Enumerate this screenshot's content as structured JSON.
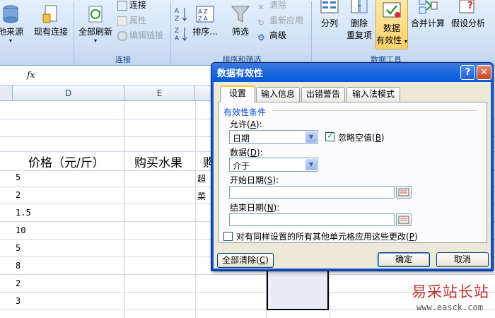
{
  "ribbon": {
    "get_data": {
      "from_other_sources": "他来源",
      "existing_connections": "现有连接"
    },
    "connections": {
      "refresh_all": "全部刷新",
      "connections": "连接",
      "properties": "属性",
      "edit_links": "编辑链接",
      "group_title": "连接"
    },
    "sort_filter": {
      "sort": "排序...",
      "filter": "筛选",
      "clear": "清除",
      "reapply": "重新应用",
      "advanced": "高级",
      "group_title": "排序和筛选"
    },
    "data_tools": {
      "text_to_columns": "分列",
      "remove_duplicates_1": "删除",
      "remove_duplicates_2": "重复项",
      "data_validation_1": "数据",
      "data_validation_2": "有效性",
      "consolidate": "合并计算",
      "what_if_1": "假设分析",
      "group_title": "数据工具"
    }
  },
  "formula_bar": {
    "fx": "fx"
  },
  "columns": [
    "D",
    "E",
    "F"
  ],
  "sheet": {
    "header_price": "价格（元/斤）",
    "header_fruit": "购买水果",
    "header_f_partial": "购",
    "values": [
      "5",
      "2",
      "1.5",
      "10",
      "5",
      "8",
      "2",
      "3"
    ],
    "f_col_partial": [
      "超",
      "菜"
    ]
  },
  "dialog": {
    "title": "数据有效性",
    "help": "?",
    "close": "✕",
    "tabs": [
      "设置",
      "输入信息",
      "出错警告",
      "输入法模式"
    ],
    "section_title": "有效性条件",
    "allow_label": "允许(",
    "allow_key": "A",
    "allow_value": "日期",
    "ignore_blank_label": "忽略空值(",
    "ignore_blank_key": "B",
    "data_label": "数据(",
    "data_key": "D",
    "data_value": "介于",
    "start_date_label": "开始日期(",
    "start_date_key": "S",
    "end_date_label": "结束日期(",
    "end_date_key": "N",
    "apply_all_label": "对有同样设置的所有其他单元格应用这些更改(",
    "apply_all_key": "P",
    "close_paren": "):",
    "close_paren_plain": ")",
    "clear_all": "全部清除(",
    "clear_all_key": "C",
    "ok": "确定",
    "cancel": "取消"
  },
  "watermark": {
    "text": "易采站长站",
    "url": "www.easck.com"
  },
  "colors": {
    "dialog_title_bar": "#0a50c8",
    "accent_tab": "#ffc83c",
    "watermark": "#c0302c"
  }
}
